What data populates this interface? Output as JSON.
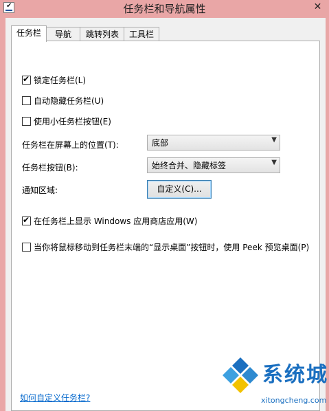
{
  "window": {
    "title": "任务栏和导航属性",
    "close_glyph": "✕"
  },
  "tabs": [
    {
      "label": "任务栏",
      "active": true
    },
    {
      "label": "导航",
      "active": false
    },
    {
      "label": "跳转列表",
      "active": false
    },
    {
      "label": "工具栏",
      "active": false
    }
  ],
  "options": {
    "lock_taskbar": {
      "label": "锁定任务栏(L)",
      "checked": true
    },
    "auto_hide": {
      "label": "自动隐藏任务栏(U)",
      "checked": false
    },
    "small_buttons": {
      "label": "使用小任务栏按钮(E)",
      "checked": false
    },
    "location": {
      "label": "任务栏在屏幕上的位置(T):",
      "value": "底部"
    },
    "buttons": {
      "label": "任务栏按钮(B):",
      "value": "始终合并、隐藏标签"
    },
    "notify": {
      "label": "通知区域:",
      "button": "自定义(C)..."
    },
    "store_apps": {
      "label": "在任务栏上显示 Windows 应用商店应用(W)",
      "checked": true
    },
    "peek": {
      "label": "当你将鼠标移动到任务栏末端的“显示桌面”按钮时，使用 Peek 预览桌面(P)",
      "checked": false
    }
  },
  "help_link": "如何自定义任务栏?",
  "watermark": {
    "brand": "系统城",
    "url": "xitongcheng.com"
  },
  "checkmark": "✔",
  "dropdown_arrow": "▼",
  "accent_color": "#e9a6a6"
}
